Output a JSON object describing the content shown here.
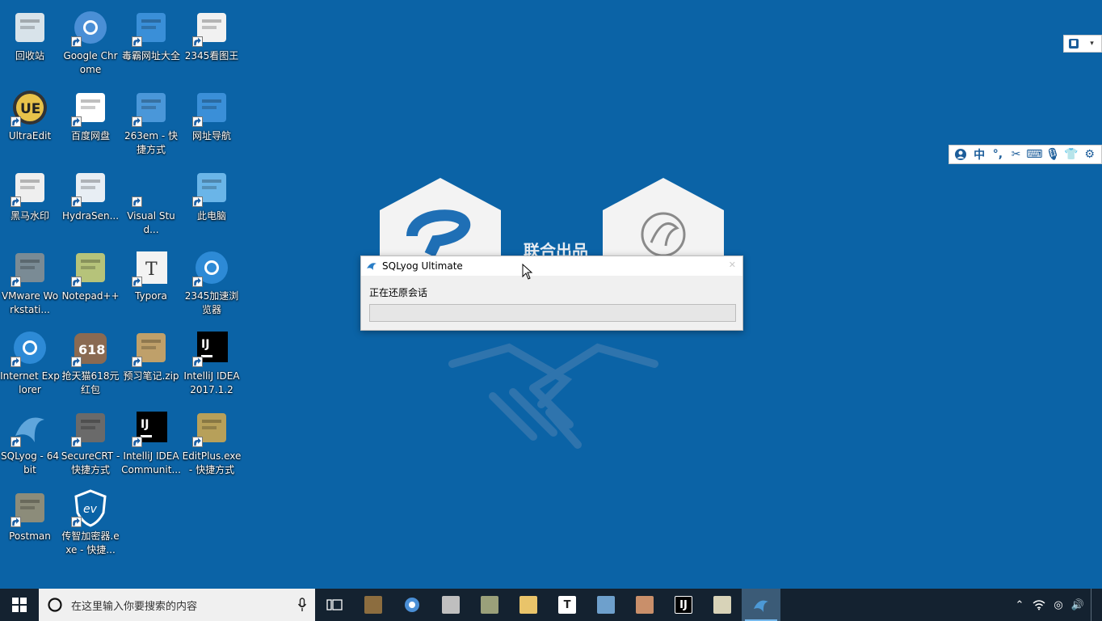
{
  "desktop": {
    "icons": [
      {
        "label": "回收站",
        "icon": "recycle-bin-icon"
      },
      {
        "label": "Google Chrome",
        "icon": "chrome-icon"
      },
      {
        "label": "毒霸网址大全",
        "icon": "ie-style-icon"
      },
      {
        "label": "2345看图王",
        "icon": "image-viewer-icon"
      },
      {
        "label": "UltraEdit",
        "icon": "ultraedit-icon"
      },
      {
        "label": "百度网盘",
        "icon": "baidu-netdisk-icon"
      },
      {
        "label": "263em - 快捷方式",
        "icon": "263em-icon"
      },
      {
        "label": "网址导航",
        "icon": "ie-style-icon"
      },
      {
        "label": "黑马水印",
        "icon": "watermark-icon"
      },
      {
        "label": "HydraSen...",
        "icon": "hydra-icon"
      },
      {
        "label": "Visual Stud...",
        "icon": "visual-studio-icon"
      },
      {
        "label": "此电脑",
        "icon": "this-pc-icon"
      },
      {
        "label": "VMware Workstati...",
        "icon": "vmware-icon"
      },
      {
        "label": "Notepad++",
        "icon": "notepadpp-icon"
      },
      {
        "label": "Typora",
        "icon": "typora-icon"
      },
      {
        "label": "2345加速浏览器",
        "icon": "browser-2345-icon"
      },
      {
        "label": "Internet Explorer",
        "icon": "internet-explorer-icon"
      },
      {
        "label": "抢天猫618元红包",
        "icon": "tmall-618-icon"
      },
      {
        "label": "预习笔记.zip",
        "icon": "zip-archive-icon"
      },
      {
        "label": "IntelliJ IDEA 2017.1.2 x...",
        "icon": "intellij-icon"
      },
      {
        "label": "SQLyog - 64 bit",
        "icon": "sqlyog-icon"
      },
      {
        "label": "SecureCRT - 快捷方式",
        "icon": "securecrt-icon"
      },
      {
        "label": "IntelliJ IDEA Communit...",
        "icon": "intellij-icon"
      },
      {
        "label": "EditPlus.exe - 快捷方式",
        "icon": "editplus-icon"
      },
      {
        "label": "Postman",
        "icon": "postman-icon"
      },
      {
        "label": "传智加密器.exe - 快捷...",
        "icon": "encryptor-icon"
      }
    ]
  },
  "splash": {
    "text": "联合出品"
  },
  "dialog": {
    "title": "SQLyog Ultimate",
    "message": "正在还原会话",
    "progress": 0
  },
  "ime": {
    "mini": [
      "user-icon",
      "dropdown-icon"
    ],
    "bar_mode": "中",
    "items": [
      "user-icon",
      "punctuation-icon",
      "scissors-icon",
      "keyboard-icon",
      "microphone-icon",
      "shirt-icon",
      "gear-icon"
    ]
  },
  "taskbar": {
    "search_placeholder": "在这里输入你要搜索的内容",
    "apps": [
      {
        "name": "task-view",
        "label": "",
        "color": "#ffffff"
      },
      {
        "name": "winrar",
        "label": "",
        "color": "#8c6d3f"
      },
      {
        "name": "chrome",
        "label": "",
        "color": "#4a8fd6"
      },
      {
        "name": "edge",
        "label": "",
        "color": "#bfbfbf"
      },
      {
        "name": "notepad",
        "label": "",
        "color": "#9aa07a"
      },
      {
        "name": "file-explorer",
        "label": "",
        "color": "#e9c46a"
      },
      {
        "name": "typora",
        "label": "T",
        "color": "#ffffff"
      },
      {
        "name": "vmware",
        "label": "",
        "color": "#6ea0cc"
      },
      {
        "name": "image-viewer",
        "label": "",
        "color": "#c98f6a"
      },
      {
        "name": "intellij",
        "label": "IJ",
        "color": "#000000"
      },
      {
        "name": "editplus",
        "label": "",
        "color": "#d8d3b8"
      },
      {
        "name": "sqlyog",
        "label": "",
        "color": "#2d7fc1"
      }
    ]
  }
}
